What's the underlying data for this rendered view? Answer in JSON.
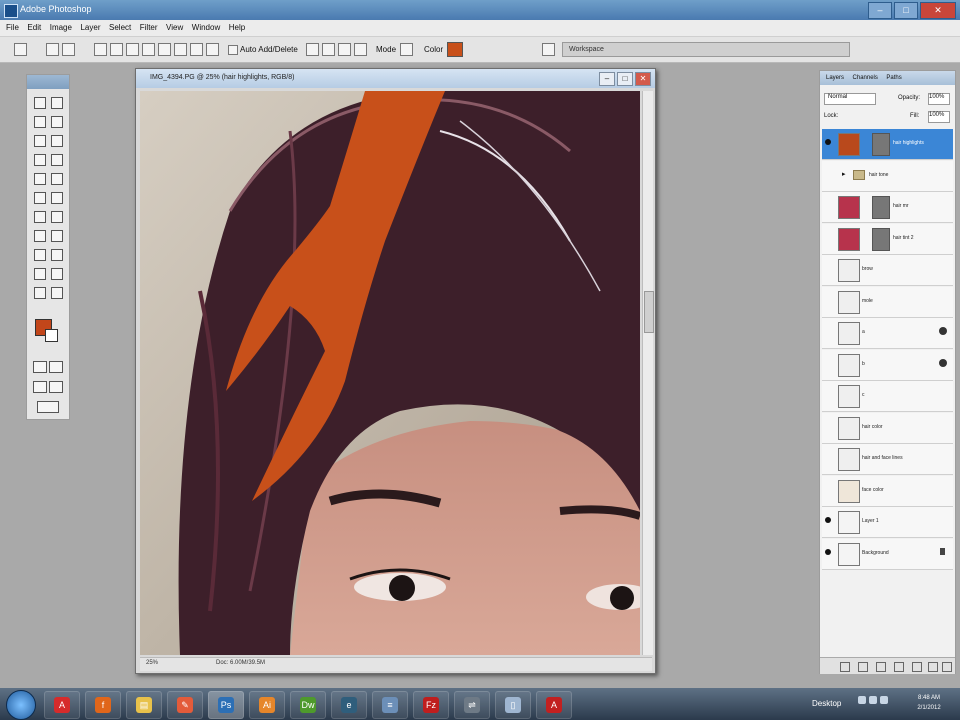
{
  "window": {
    "title": "Adobe Photoshop"
  },
  "menu": [
    "File",
    "Edit",
    "Image",
    "Layer",
    "Select",
    "Filter",
    "View",
    "Window",
    "Help"
  ],
  "options": {
    "auto_add_delete_label": "Auto Add/Delete",
    "mode_label": "Mode",
    "color_label": "Color",
    "color_value": "#c8501a",
    "workspace_label": "Workspace"
  },
  "toolbox": {
    "foreground_color": "#c2461a",
    "background_color": "#ffffff"
  },
  "document": {
    "title": "IMG_4394.PG @ 25% (hair highlights, RGB/8)",
    "zoom": "25%",
    "doc_info": "Doc: 6.00M/39.5M",
    "highlight_color": "#c8501a"
  },
  "layers_panel": {
    "tabs": [
      "Layers",
      "Channels",
      "Paths"
    ],
    "blend_mode": "Normal",
    "opacity_label": "Opacity:",
    "opacity": "100%",
    "lock_label": "Lock:",
    "fill_label": "Fill:",
    "fill": "100%",
    "layers": [
      {
        "name": "hair highlights",
        "thumb": "#b9491c",
        "mask": true,
        "visible": true,
        "selected": true
      },
      {
        "name": "hair tone",
        "group": true,
        "visible": false
      },
      {
        "name": "hair mr",
        "thumb": "#b7334c",
        "mask": true,
        "visible": false
      },
      {
        "name": "hair tint 2",
        "thumb": "#b7334c",
        "mask": true,
        "visible": false
      },
      {
        "name": "brow",
        "thumb": "#efefef",
        "visible": false
      },
      {
        "name": "mole",
        "thumb": "#efefef",
        "visible": false
      },
      {
        "name": "a",
        "thumb": "#efefef",
        "visible": false,
        "fx": true
      },
      {
        "name": "b",
        "thumb": "#efefef",
        "visible": false,
        "fx": true
      },
      {
        "name": "c",
        "thumb": "#efefef",
        "visible": false
      },
      {
        "name": "hair color",
        "thumb": "#efefef",
        "visible": false
      },
      {
        "name": "hair and face lines",
        "thumb": "#efefef",
        "visible": false
      },
      {
        "name": "face color",
        "thumb": "#efe6d9",
        "visible": false
      },
      {
        "name": "Layer 1",
        "thumb": "#f4f4f4",
        "visible": true
      },
      {
        "name": "Background",
        "thumb": "#f4f4f4",
        "visible": true,
        "locked": true
      }
    ]
  },
  "taskbar": {
    "desktop_label": "Desktop",
    "time": "8:48 AM",
    "date": "2/1/2012",
    "apps": [
      {
        "name": "acrobat",
        "color": "#d62b2b",
        "glyph": "A"
      },
      {
        "name": "firefox",
        "color": "#e0661a",
        "glyph": "f"
      },
      {
        "name": "explorer",
        "color": "#e8c24b",
        "glyph": "▤"
      },
      {
        "name": "paint",
        "color": "#e35b3a",
        "glyph": "✎"
      },
      {
        "name": "photoshop",
        "color": "#2c6fb5",
        "glyph": "Ps"
      },
      {
        "name": "illustrator",
        "color": "#e6862a",
        "glyph": "Ai"
      },
      {
        "name": "dreamweaver",
        "color": "#4e9a2c",
        "glyph": "Dw"
      },
      {
        "name": "edge",
        "color": "#2f5e7c",
        "glyph": "e"
      },
      {
        "name": "notes",
        "color": "#6c8fb8",
        "glyph": "≡"
      },
      {
        "name": "filezilla",
        "color": "#bf1e1e",
        "glyph": "Fz"
      },
      {
        "name": "network",
        "color": "#6e7a86",
        "glyph": "⇌"
      },
      {
        "name": "document",
        "color": "#9fb6d1",
        "glyph": "▯"
      },
      {
        "name": "adobe-reader",
        "color": "#c22020",
        "glyph": "A"
      }
    ]
  }
}
